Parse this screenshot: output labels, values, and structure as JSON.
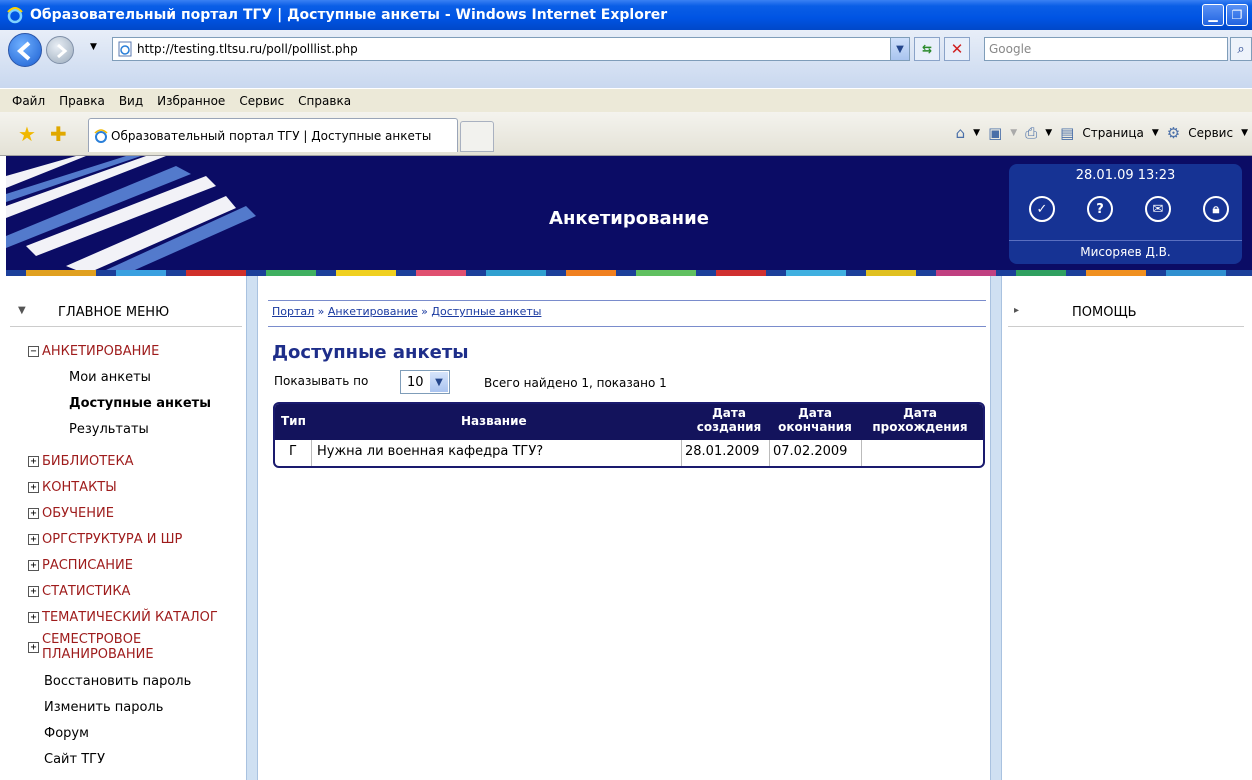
{
  "window": {
    "title": "Образовательный портал ТГУ | Доступные анкеты - Windows Internet Explorer"
  },
  "address": {
    "url": "http://testing.tltsu.ru/poll/polllist.php",
    "search_placeholder": "Google"
  },
  "menubar": [
    "Файл",
    "Правка",
    "Вид",
    "Избранное",
    "Сервис",
    "Справка"
  ],
  "tab": {
    "label": "Образовательный портал ТГУ | Доступные анкеты"
  },
  "commandbar": {
    "page_label": "Страница",
    "tools_label": "Сервис"
  },
  "banner": {
    "title": "Анкетирование",
    "datetime": "28.01.09 13:23",
    "user": "Мисоряев Д.В.",
    "icons": [
      "check-icon",
      "help-icon",
      "mail-icon",
      "lock-icon"
    ]
  },
  "sidebar": {
    "header": "ГЛАВНОЕ МЕНЮ",
    "sections": [
      {
        "label": "АНКЕТИРОВАНИЕ",
        "expanded": true,
        "items": [
          "Мои анкеты",
          "Доступные анкеты",
          "Результаты"
        ]
      },
      {
        "label": "БИБЛИОТЕКА"
      },
      {
        "label": "КОНТАКТЫ"
      },
      {
        "label": "ОБУЧЕНИЕ"
      },
      {
        "label": "ОРГСТРУКТУРА И ШР"
      },
      {
        "label": "РАСПИСАНИЕ"
      },
      {
        "label": "СТАТИСТИКА"
      },
      {
        "label": "ТЕМАТИЧЕСКИЙ КАТАЛОГ"
      },
      {
        "label": "СЕМЕСТРОВОЕ",
        "label2": "ПЛАНИРОВАНИЕ"
      }
    ],
    "links": [
      "Восстановить пароль",
      "Изменить пароль",
      "Форум",
      "Сайт ТГУ"
    ]
  },
  "main": {
    "breadcrumb": [
      "Портал",
      "Анкетирование",
      "Доступные анкеты"
    ],
    "breadcrumb_sep": "»",
    "title": "Доступные анкеты",
    "show_label": "Показывать по",
    "page_size": "10",
    "found_text": "Всего найдено 1, показано 1",
    "table": {
      "headers": {
        "type": "Тип",
        "name": "Название",
        "created": [
          "Дата",
          "создания"
        ],
        "ends": [
          "Дата",
          "окончания"
        ],
        "passed": [
          "Дата",
          "прохождения"
        ]
      },
      "rows": [
        {
          "type": "Г",
          "name": "Нужна ли военная кафедра ТГУ?",
          "created": "28.01.2009",
          "ends": "07.02.2009",
          "passed": ""
        }
      ]
    }
  },
  "help": {
    "header": "ПОМОЩЬ"
  },
  "colors": {
    "banner_bg": "#0b0c65",
    "userbox_bg": "#163394",
    "menu_accent": "#9e1b1b",
    "table_header_bg": "#13135c",
    "title_color": "#1e2e8a"
  }
}
